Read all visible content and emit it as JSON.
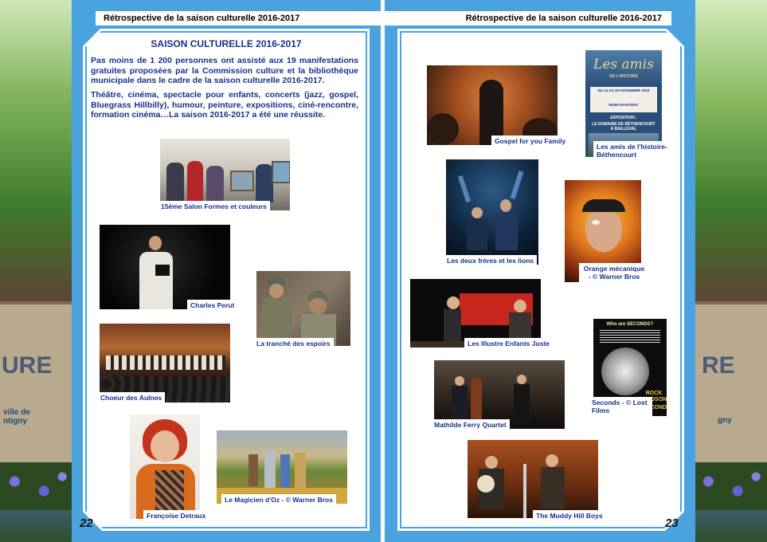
{
  "header": {
    "left_title": "Rétrospective de la saison culturelle 2016-2017",
    "right_title": "Rétrospective de la saison culturelle 2016-2017"
  },
  "page_numbers": {
    "left": "22",
    "right": "23"
  },
  "article": {
    "title": "SAISON CULTURELLE 2016-2017",
    "paragraph1": "Pas moins de 1 200 personnes ont assisté aux 19 manifestations gratuites proposées par la Commission culture et la bibliothèque municipale dans le cadre de la saison culturelle 2016-2017.",
    "paragraph2": "Théâtre, cinéma, spectacle pour enfants, concerts (jazz, gospel, Bluegrass Hillbilly), humour, peinture, expositions, ciné-rencontre, formation cinéma…La saison 2016-2017 a été une réussite."
  },
  "background": {
    "sign_text_left": "URE",
    "sign_sub_left": "ville de\nntigny",
    "sign_text_right": "RE",
    "sign_sub_right": "gny"
  },
  "poster_amis": {
    "title": "Les amis",
    "subtitle": "DE L'HISTOIRE",
    "dates": "DU 14 AU 26 NOVEMBRE 2016",
    "location": "60290 RANTIGNY",
    "expo": "EXPOSITION :",
    "expo_title": "LE DOMAINE DE BÉTHENCOURT À BAILLEVAL"
  },
  "poster_seconds": {
    "top": "Who are SECONDS?",
    "bottom": "ROCK HUDSON",
    "bottom2": "SECONDS"
  },
  "captions": {
    "salon": "15ème Salon Formes et couleurs",
    "perut": "Charles Perut",
    "tranche": "La tranché des espoirs",
    "choeur": "Choeur des Aulnes",
    "detraux": "Françoise Detraux",
    "oz": "Le Magicien d'Oz - © Warner Bros",
    "gospel": "Gospel for you Family",
    "amis": "Les amis de l'histoire-Béthencourt",
    "freres": "Les deux frères et les lions",
    "orange": "Orange mécanique - © Warner Bros",
    "illustre": "Les Illustre Enfants Juste",
    "seconds": "Seconds - © Lost Films",
    "mathilde": "Mathilde Ferry Quartet",
    "muddy": "The Muddy Hill Boys"
  },
  "colors": {
    "accent_blue": "#4aa3df",
    "text_blue": "#17328a"
  }
}
